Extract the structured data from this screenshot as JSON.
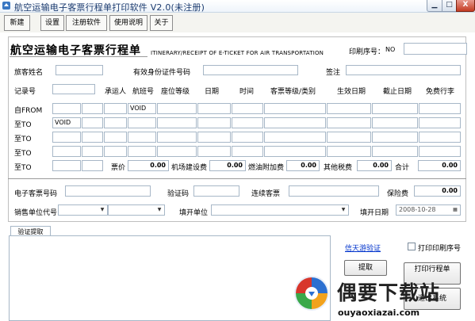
{
  "window": {
    "title": "航空运输电子客票行程单打印软件 V2.0(未注册)",
    "minimize": "▁",
    "maximize": "□",
    "close": "X"
  },
  "toolbar": {
    "new": "新建",
    "settings": "设置",
    "register": "注册软件",
    "help": "使用说明",
    "about": "关于"
  },
  "header": {
    "title": "航空运输电子客票行程单",
    "subtitle": "ITINERARY/RECEIPT OF E-TICKET FOR AIR TRANSPORTATION",
    "print_serial_label": "印刷序号：",
    "print_serial_prefix": "NO",
    "print_serial_value": ""
  },
  "passenger": {
    "name_label": "旅客姓名",
    "id_label": "有效身份证件号码",
    "endorse_label": "签注"
  },
  "grid": {
    "headers": {
      "pnr": "记录号",
      "carrier": "承运人",
      "flight": "航班号",
      "class": "座位等级",
      "date": "日期",
      "time": "时间",
      "fare_basis": "客票等级/类别",
      "valid_from": "生效日期",
      "valid_to": "截止日期",
      "baggage": "免费行李"
    },
    "from_label": "自FROM",
    "to_label": "至TO",
    "void_text": "VOID"
  },
  "fees": {
    "fare_label": "票价",
    "fare": "0.00",
    "airport_label": "机场建设费",
    "airport": "0.00",
    "fuel_label": "燃油附加费",
    "fuel": "0.00",
    "other_label": "其他税费",
    "other": "0.00",
    "total_label": "合计",
    "total": "0.00"
  },
  "ticket": {
    "eticket_label": "电子客票号码",
    "verify_label": "验证码",
    "conj_label": "连续客票",
    "insurance_label": "保险费",
    "insurance": "0.00",
    "agent_label": "销售单位代号",
    "issuer_label": "填开单位",
    "issue_date_label": "填开日期",
    "issue_date": "2008-10-28"
  },
  "bottom": {
    "tab_label": "验证提取",
    "link_text": "信天游验证",
    "extract_button": "提取",
    "print_serial_checkbox": "打印印刷序号",
    "print_button": "打印行程单",
    "exit_button": "退出系统"
  },
  "watermark": {
    "text": "偶要下载站",
    "url": "ouyaoxiazai.com"
  }
}
